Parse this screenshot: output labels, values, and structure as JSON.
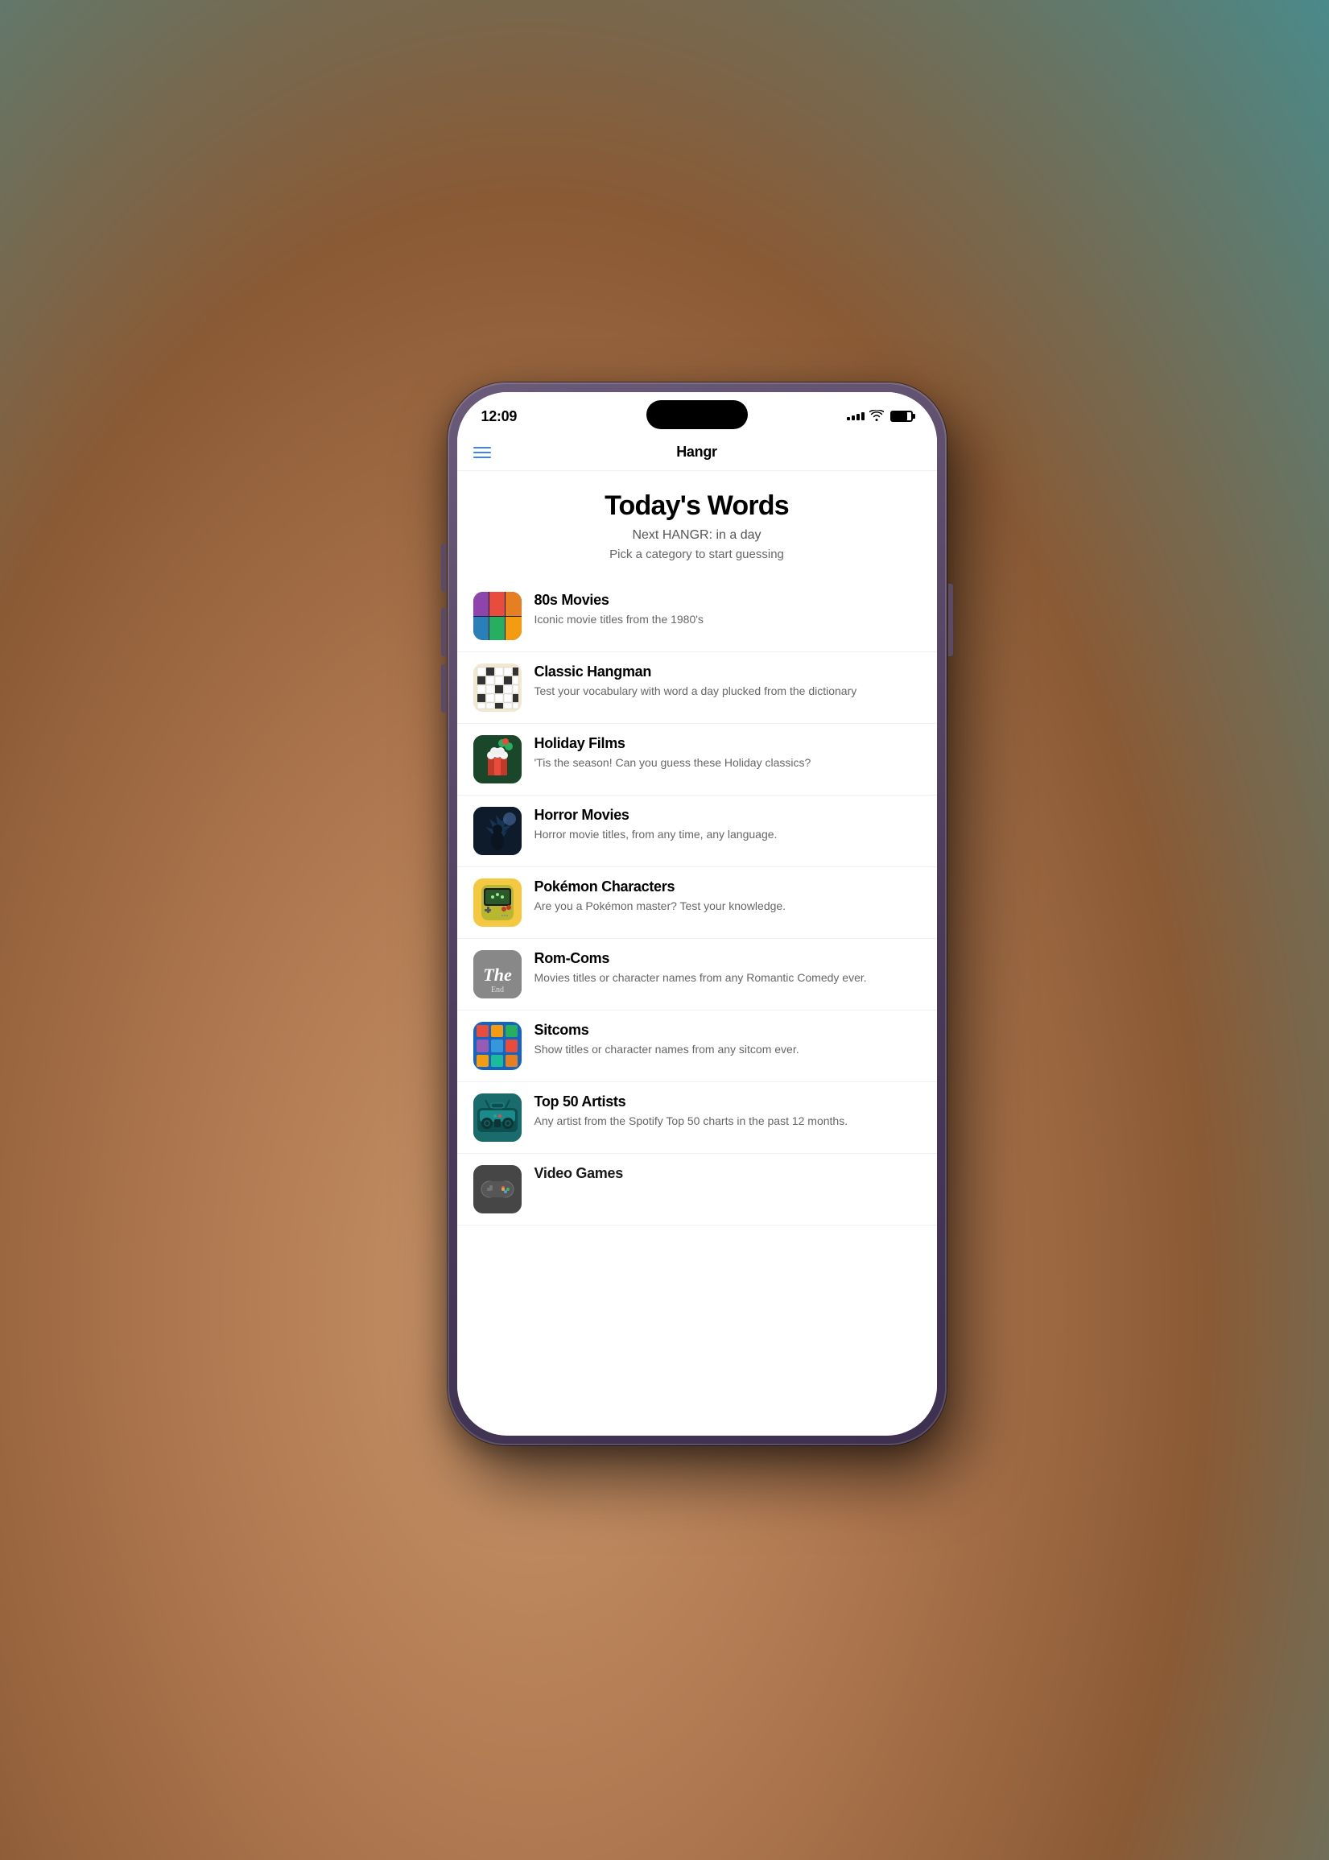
{
  "status_bar": {
    "time": "12:09",
    "signal_bars": [
      3,
      5,
      7,
      9,
      11
    ],
    "wifi": "wifi",
    "battery": 80
  },
  "header": {
    "title": "Hangr",
    "menu_icon": "hamburger"
  },
  "page": {
    "title": "Today's Words",
    "next_hangr": "Next HANGR: in a day",
    "pick_category": "Pick a category to start guessing"
  },
  "categories": [
    {
      "id": "80s-movies",
      "name": "80s Movies",
      "description": "Iconic movie titles from the 1980's",
      "thumb_type": "80s"
    },
    {
      "id": "classic-hangman",
      "name": "Classic Hangman",
      "description": "Test your vocabulary with word a day plucked from the dictionary",
      "thumb_type": "classic"
    },
    {
      "id": "holiday-films",
      "name": "Holiday Films",
      "description": "'Tis the season! Can you guess these Holiday classics?",
      "thumb_type": "holiday"
    },
    {
      "id": "horror-movies",
      "name": "Horror Movies",
      "description": "Horror movie titles, from any time, any language.",
      "thumb_type": "horror"
    },
    {
      "id": "pokemon",
      "name": "Pokémon Characters",
      "description": "Are you a Pokémon master? Test your knowledge.",
      "thumb_type": "pokemon"
    },
    {
      "id": "rom-coms",
      "name": "Rom-Coms",
      "description": "Movies titles or character names from any Romantic Comedy ever.",
      "thumb_type": "romcom"
    },
    {
      "id": "sitcoms",
      "name": "Sitcoms",
      "description": "Show titles or character names from any sitcom ever.",
      "thumb_type": "sitcoms"
    },
    {
      "id": "top-50-artists",
      "name": "Top 50 Artists",
      "description": "Any artist from the Spotify Top 50 charts in the past 12 months.",
      "thumb_type": "top50"
    },
    {
      "id": "video-games",
      "name": "Video Games",
      "description": "",
      "thumb_type": "videogames"
    }
  ]
}
